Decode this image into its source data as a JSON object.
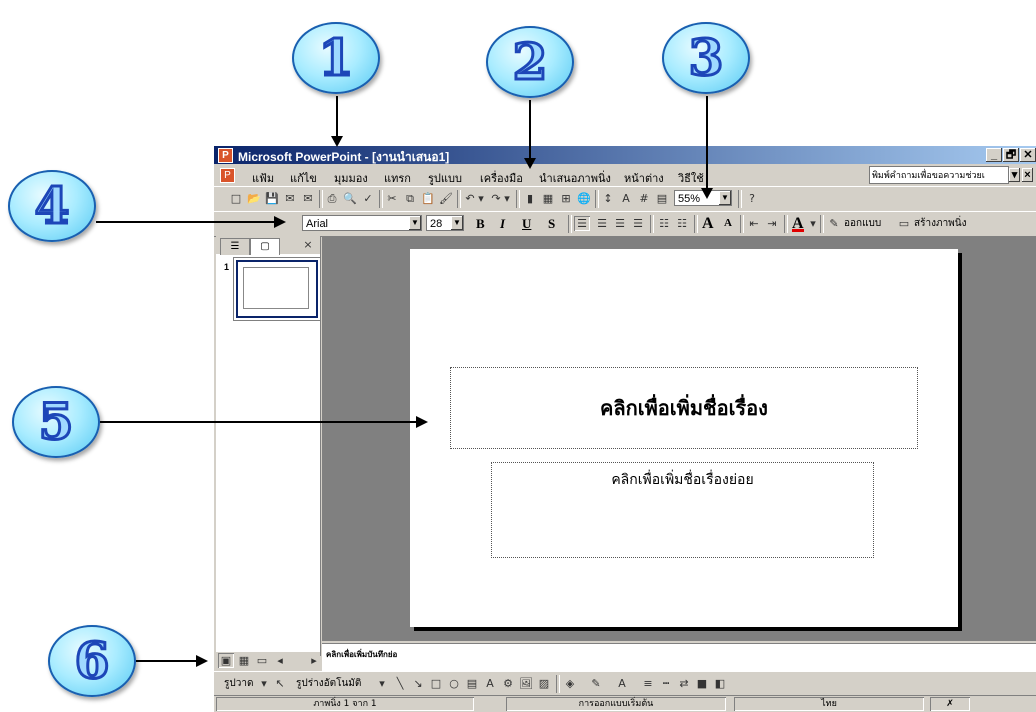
{
  "callouts": [
    "1",
    "2",
    "3",
    "4",
    "5",
    "6"
  ],
  "window": {
    "title": "Microsoft PowerPoint - [งานนำเสนอ1]",
    "controls": [
      "_",
      "🗗",
      "✕"
    ]
  },
  "menu": {
    "items": [
      "แฟ้ม",
      "แก้ไข",
      "มุมมอง",
      "แทรก",
      "รูปแบบ",
      "เครื่องมือ",
      "นำเสนอภาพนิ่ง",
      "หน้าต่าง",
      "วิธีใช้"
    ],
    "help_placeholder": "พิมพ์คำถามเพื่อขอความช่วยเ"
  },
  "standard_toolbar": {
    "zoom": "55%"
  },
  "formatting_toolbar": {
    "font": "Arial",
    "size": "28",
    "bold": "B",
    "italic": "I",
    "underline": "U",
    "shadow": "S",
    "grow_font": "A",
    "shrink_font": "A",
    "font_color": "A",
    "design_label": "ออกแบบ",
    "new_slide_label": "สร้างภาพนิ่ง"
  },
  "left_pane": {
    "slide_number": "1"
  },
  "slide": {
    "title_placeholder": "คลิกเพื่อเพิ่มชื่อเรื่อง",
    "subtitle_placeholder": "คลิกเพื่อเพิ่มชื่อเรื่องย่อย"
  },
  "notes": {
    "placeholder": "คลิกเพื่อเพิ่มบันทึกย่อ"
  },
  "drawing_toolbar": {
    "draw_label": "รูปวาด",
    "autoshapes_label": "รูปร่างอัตโนมัติ"
  },
  "status": {
    "slide_pos": "ภาพนิ่ง 1 จาก 1",
    "design": "การออกแบบเริ่มต้น",
    "language": "ไทย"
  }
}
